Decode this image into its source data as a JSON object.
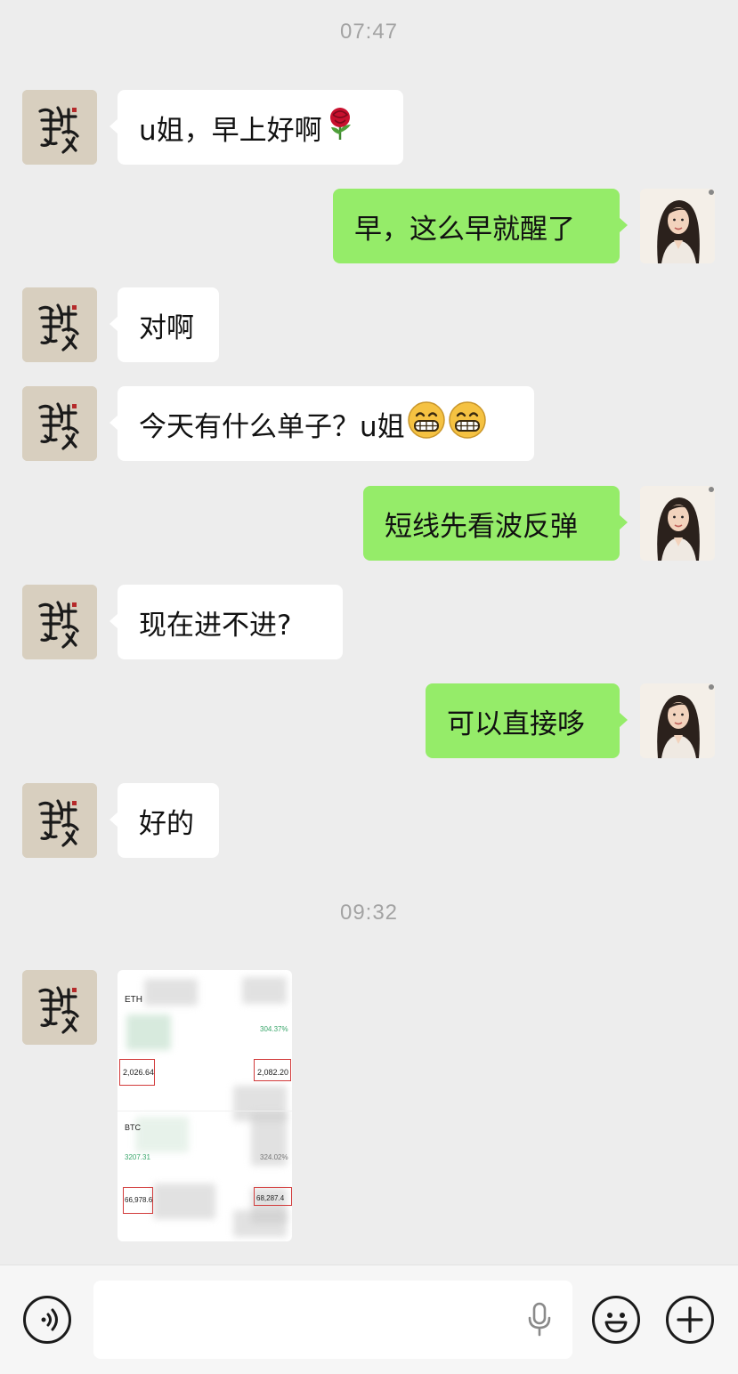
{
  "timestamps": [
    "07:47",
    "09:32"
  ],
  "messages": [
    {
      "side": "left",
      "text": "u姐，早上好啊",
      "emoji": "rose"
    },
    {
      "side": "right",
      "text": "早，这么早就醒了"
    },
    {
      "side": "left",
      "text": "对啊"
    },
    {
      "side": "left",
      "text": "今天有什么单子？u姐",
      "emoji": "grin-x2"
    },
    {
      "side": "right",
      "text": "短线先看波反弹"
    },
    {
      "side": "left",
      "text": "现在进不进?"
    },
    {
      "side": "right",
      "text": "可以直接哆"
    },
    {
      "side": "left",
      "text": "好的"
    }
  ],
  "image_message": {
    "label_top": "ETH",
    "percent": "304.37%",
    "val_1": "2,026.64",
    "val_2": "2,082.20",
    "label_bottom": "BTC",
    "val_3": "3207.31",
    "val_4": "324.02%",
    "val_5": "66,978.6",
    "val_6": "68,287.4"
  },
  "bottom_bar": {
    "voice_icon": "voice-icon",
    "mic_icon": "mic-icon",
    "emoji_icon": "emoji-icon",
    "plus_icon": "plus-icon"
  },
  "colors": {
    "background": "#ededed",
    "bubble_self": "#95ec69",
    "bubble_other": "#ffffff",
    "timestamp": "#a3a3a3"
  }
}
